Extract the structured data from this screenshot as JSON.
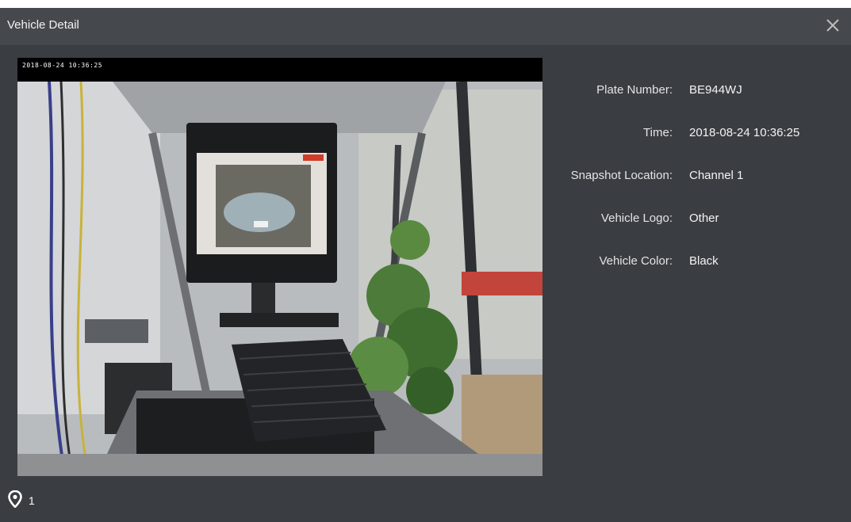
{
  "window": {
    "title": "Vehicle Detail",
    "close_icon": "close-icon"
  },
  "snapshot": {
    "osd_text": "2018-08-24 10:36:25",
    "description": "",
    "monitor_badge": ""
  },
  "details": [
    {
      "label": "Plate Number:",
      "value": "BE944WJ"
    },
    {
      "label": "Time:",
      "value": "2018-08-24 10:36:25"
    },
    {
      "label": "Snapshot Location:",
      "value": "Channel 1"
    },
    {
      "label": "Vehicle Logo:",
      "value": "Other"
    },
    {
      "label": "Vehicle Color:",
      "value": "Black"
    }
  ],
  "footer": {
    "icon": "location-pin-icon",
    "count": "1"
  },
  "colors": {
    "background": "#3a3d42",
    "titlebar": "#45484d",
    "text": "#e8e8e8"
  }
}
